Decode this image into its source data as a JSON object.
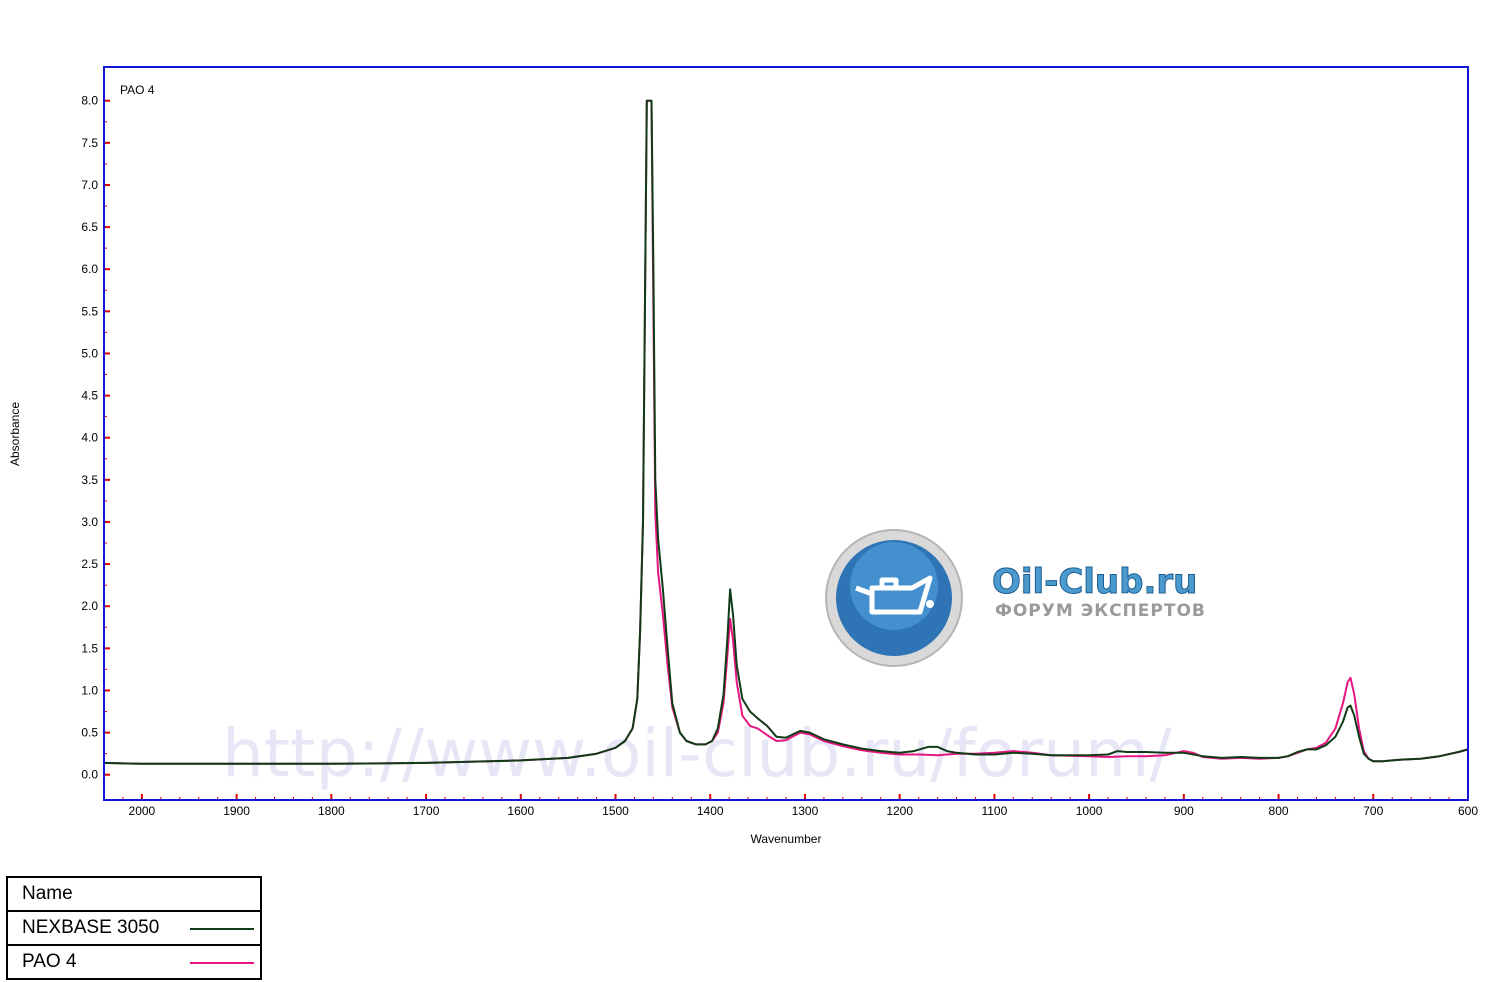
{
  "chart_data": {
    "type": "line",
    "plot_label": "PAO 4",
    "xlabel": "Wavenumber",
    "ylabel": "Absorbance",
    "xlim": [
      2040,
      600
    ],
    "ylim": [
      -0.3,
      8.4
    ],
    "x_reversed": true,
    "x_ticks": [
      2000,
      1900,
      1800,
      1700,
      1600,
      1500,
      1400,
      1300,
      1200,
      1100,
      1000,
      900,
      800,
      700,
      600
    ],
    "y_ticks": [
      "0.0",
      "0.5",
      "1.0",
      "1.5",
      "2.0",
      "2.5",
      "3.0",
      "3.5",
      "4.0",
      "4.5",
      "5.0",
      "5.5",
      "6.0",
      "6.5",
      "7.0",
      "7.5",
      "8.0"
    ],
    "legend_header": "Name",
    "series": [
      {
        "name": "NEXBASE 3050",
        "color": "#0f3b17",
        "points": [
          [
            2040,
            0.14
          ],
          [
            2000,
            0.13
          ],
          [
            1900,
            0.13
          ],
          [
            1800,
            0.13
          ],
          [
            1700,
            0.14
          ],
          [
            1600,
            0.17
          ],
          [
            1550,
            0.2
          ],
          [
            1520,
            0.25
          ],
          [
            1500,
            0.32
          ],
          [
            1490,
            0.4
          ],
          [
            1482,
            0.55
          ],
          [
            1477,
            0.9
          ],
          [
            1474,
            1.7
          ],
          [
            1471,
            3.0
          ],
          [
            1469,
            5.5
          ],
          [
            1467,
            8.0
          ],
          [
            1462,
            8.0
          ],
          [
            1460,
            6.0
          ],
          [
            1458,
            3.5
          ],
          [
            1455,
            2.8
          ],
          [
            1450,
            2.2
          ],
          [
            1445,
            1.5
          ],
          [
            1440,
            0.85
          ],
          [
            1432,
            0.5
          ],
          [
            1425,
            0.4
          ],
          [
            1415,
            0.36
          ],
          [
            1405,
            0.36
          ],
          [
            1398,
            0.4
          ],
          [
            1392,
            0.55
          ],
          [
            1386,
            0.95
          ],
          [
            1382,
            1.6
          ],
          [
            1379,
            2.2
          ],
          [
            1376,
            1.9
          ],
          [
            1372,
            1.3
          ],
          [
            1366,
            0.9
          ],
          [
            1358,
            0.75
          ],
          [
            1350,
            0.67
          ],
          [
            1340,
            0.58
          ],
          [
            1330,
            0.45
          ],
          [
            1320,
            0.44
          ],
          [
            1305,
            0.52
          ],
          [
            1295,
            0.5
          ],
          [
            1280,
            0.42
          ],
          [
            1260,
            0.36
          ],
          [
            1240,
            0.31
          ],
          [
            1220,
            0.28
          ],
          [
            1200,
            0.26
          ],
          [
            1185,
            0.28
          ],
          [
            1170,
            0.33
          ],
          [
            1160,
            0.33
          ],
          [
            1150,
            0.28
          ],
          [
            1140,
            0.26
          ],
          [
            1120,
            0.24
          ],
          [
            1100,
            0.24
          ],
          [
            1080,
            0.26
          ],
          [
            1060,
            0.25
          ],
          [
            1040,
            0.23
          ],
          [
            1000,
            0.23
          ],
          [
            980,
            0.24
          ],
          [
            970,
            0.28
          ],
          [
            960,
            0.27
          ],
          [
            940,
            0.27
          ],
          [
            920,
            0.26
          ],
          [
            900,
            0.26
          ],
          [
            880,
            0.22
          ],
          [
            860,
            0.2
          ],
          [
            840,
            0.21
          ],
          [
            820,
            0.2
          ],
          [
            800,
            0.2
          ],
          [
            790,
            0.22
          ],
          [
            780,
            0.27
          ],
          [
            770,
            0.3
          ],
          [
            760,
            0.3
          ],
          [
            750,
            0.35
          ],
          [
            740,
            0.45
          ],
          [
            732,
            0.63
          ],
          [
            727,
            0.8
          ],
          [
            724,
            0.82
          ],
          [
            720,
            0.7
          ],
          [
            715,
            0.45
          ],
          [
            710,
            0.25
          ],
          [
            705,
            0.19
          ],
          [
            700,
            0.16
          ],
          [
            690,
            0.16
          ],
          [
            680,
            0.17
          ],
          [
            670,
            0.18
          ],
          [
            650,
            0.19
          ],
          [
            630,
            0.22
          ],
          [
            610,
            0.27
          ],
          [
            600,
            0.3
          ]
        ]
      },
      {
        "name": "PAO 4",
        "color": "#e5167f",
        "points": [
          [
            2040,
            0.14
          ],
          [
            2000,
            0.13
          ],
          [
            1900,
            0.13
          ],
          [
            1800,
            0.13
          ],
          [
            1700,
            0.14
          ],
          [
            1600,
            0.17
          ],
          [
            1550,
            0.2
          ],
          [
            1520,
            0.25
          ],
          [
            1500,
            0.32
          ],
          [
            1490,
            0.4
          ],
          [
            1482,
            0.55
          ],
          [
            1477,
            0.9
          ],
          [
            1474,
            1.7
          ],
          [
            1471,
            3.0
          ],
          [
            1469,
            5.5
          ],
          [
            1467,
            8.0
          ],
          [
            1462,
            8.0
          ],
          [
            1460,
            5.5
          ],
          [
            1458,
            3.1
          ],
          [
            1455,
            2.4
          ],
          [
            1450,
            1.9
          ],
          [
            1445,
            1.3
          ],
          [
            1440,
            0.8
          ],
          [
            1432,
            0.5
          ],
          [
            1425,
            0.4
          ],
          [
            1415,
            0.36
          ],
          [
            1405,
            0.36
          ],
          [
            1398,
            0.4
          ],
          [
            1392,
            0.5
          ],
          [
            1386,
            0.85
          ],
          [
            1382,
            1.4
          ],
          [
            1379,
            1.85
          ],
          [
            1376,
            1.6
          ],
          [
            1372,
            1.1
          ],
          [
            1366,
            0.7
          ],
          [
            1358,
            0.58
          ],
          [
            1350,
            0.55
          ],
          [
            1340,
            0.47
          ],
          [
            1330,
            0.4
          ],
          [
            1320,
            0.41
          ],
          [
            1305,
            0.5
          ],
          [
            1295,
            0.48
          ],
          [
            1280,
            0.4
          ],
          [
            1260,
            0.34
          ],
          [
            1240,
            0.29
          ],
          [
            1220,
            0.26
          ],
          [
            1200,
            0.24
          ],
          [
            1180,
            0.24
          ],
          [
            1160,
            0.23
          ],
          [
            1140,
            0.25
          ],
          [
            1120,
            0.25
          ],
          [
            1100,
            0.26
          ],
          [
            1080,
            0.28
          ],
          [
            1060,
            0.26
          ],
          [
            1040,
            0.23
          ],
          [
            1000,
            0.22
          ],
          [
            980,
            0.21
          ],
          [
            960,
            0.22
          ],
          [
            940,
            0.22
          ],
          [
            920,
            0.23
          ],
          [
            900,
            0.28
          ],
          [
            890,
            0.26
          ],
          [
            880,
            0.21
          ],
          [
            860,
            0.19
          ],
          [
            840,
            0.2
          ],
          [
            820,
            0.19
          ],
          [
            800,
            0.2
          ],
          [
            790,
            0.22
          ],
          [
            780,
            0.26
          ],
          [
            770,
            0.3
          ],
          [
            760,
            0.32
          ],
          [
            750,
            0.38
          ],
          [
            740,
            0.55
          ],
          [
            732,
            0.85
          ],
          [
            727,
            1.1
          ],
          [
            724,
            1.15
          ],
          [
            720,
            0.95
          ],
          [
            715,
            0.55
          ],
          [
            710,
            0.28
          ],
          [
            705,
            0.19
          ],
          [
            700,
            0.16
          ],
          [
            690,
            0.16
          ],
          [
            680,
            0.17
          ],
          [
            670,
            0.18
          ],
          [
            650,
            0.19
          ],
          [
            630,
            0.22
          ],
          [
            610,
            0.27
          ],
          [
            600,
            0.3
          ]
        ]
      }
    ]
  },
  "watermark": {
    "title": "Oil-Club.ru",
    "subtitle": "ФОРУМ ЭКСПЕРТОВ",
    "url": "http://www.oil-club.ru/forum/",
    "logo_icon": "oil-can-icon"
  },
  "colors": {
    "frame": "#1515d6",
    "ticks": "#e00000"
  }
}
